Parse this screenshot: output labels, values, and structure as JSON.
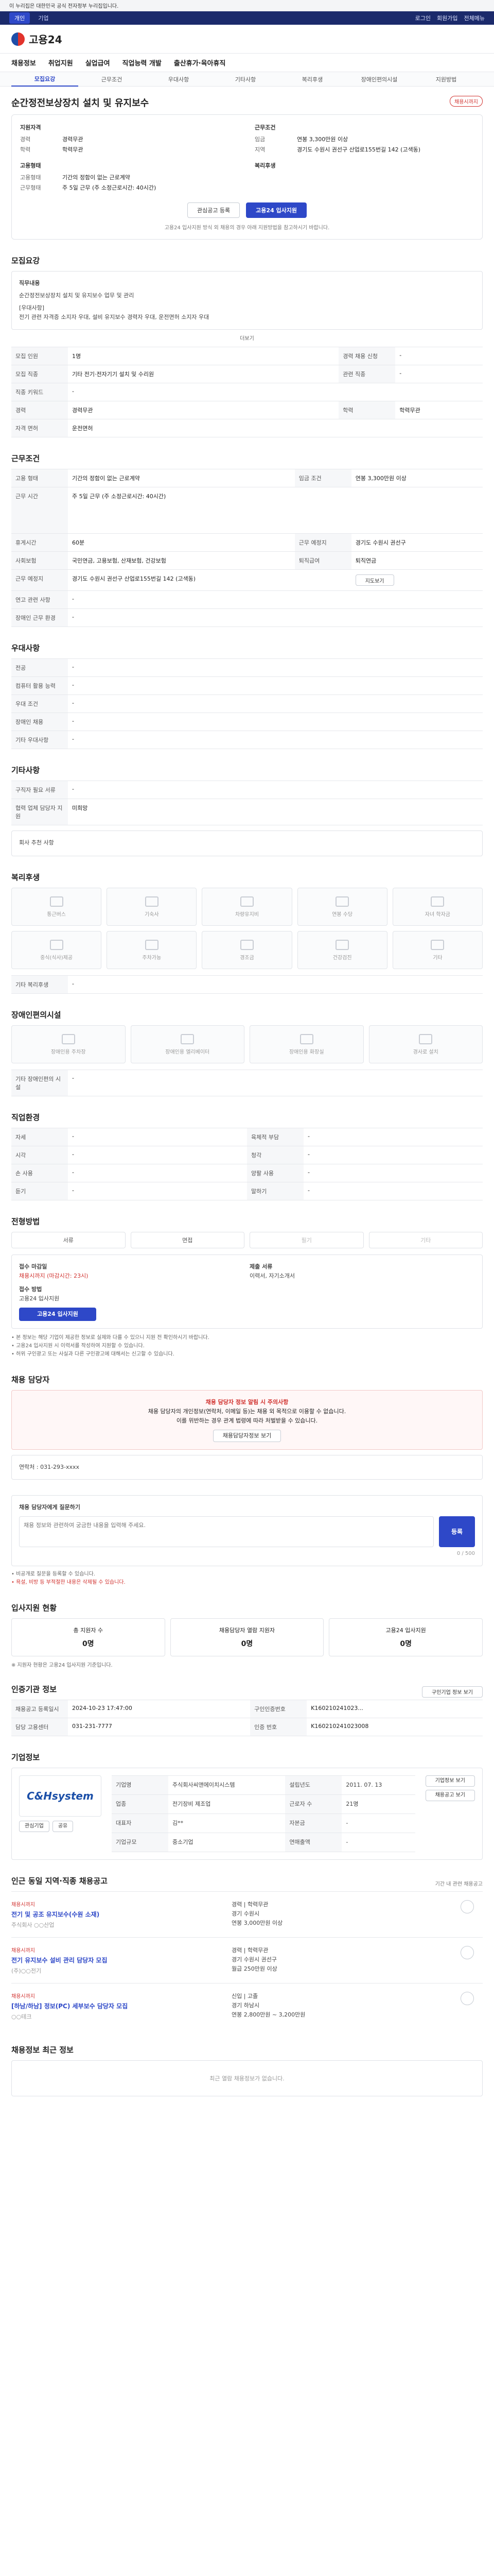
{
  "gov": {
    "text": "이 누리집은 대한민국 공식 전자정부 누리집입니다."
  },
  "site": {
    "tabs": [
      "개인",
      "기업"
    ],
    "right": [
      "로그인",
      "회원가입",
      "전체메뉴"
    ]
  },
  "logo": {
    "name": "고용24"
  },
  "gnb": [
    "채용정보",
    "취업지원",
    "실업급여",
    "직업능력 개발",
    "출산휴가·육아휴직"
  ],
  "sub_tabs": [
    "모집요강",
    "근무조건",
    "우대사항",
    "기타사항",
    "복리후생",
    "장애인편의시설",
    "지원방법"
  ],
  "job": {
    "title": "순간정전보상장치 설치 및 유지보수",
    "badge": "채용시까지"
  },
  "summary": {
    "left_h": "지원자격",
    "left": [
      {
        "k": "경력",
        "v": "경력무관"
      },
      {
        "k": "학력",
        "v": "학력무관"
      }
    ],
    "left_h2": "고용형태",
    "left2": [
      {
        "k": "고용형태",
        "v": "기간의 정함이 없는 근로계약"
      },
      {
        "k": "근무형태",
        "v": "주 5일 근무 (주 소정근로시간: 40시간)"
      }
    ],
    "right_h": "근무조건",
    "right": [
      {
        "k": "임금",
        "v": "연봉 3,300만원 이상"
      },
      {
        "k": "지역",
        "v": "경기도 수원시 권선구 산업로155번길 142 (고색동)"
      }
    ],
    "right_h2": "복리후생",
    "buttons": {
      "scrap": "관심공고 등록",
      "apply": "고용24 입사지원"
    },
    "note": "고용24 입사지원 방식 외 채용의 경우 아래 지원방법을 참고하시기 바랍니다."
  },
  "recruit": {
    "heading": "모집요강",
    "box_title": "직무내용",
    "box_lines": [
      "순간정전보상장치 설치 및 유지보수 업무 및 관리",
      "[우대사항]",
      "전기 관련 자격증 소지자 우대, 설비 유지보수 경력자 우대, 운전면허 소지자 우대"
    ],
    "more": "더보기",
    "rows": [
      {
        "k": "모집 인원",
        "v": "1명",
        "k2": "경력 채용 신청",
        "v2": "-"
      },
      {
        "k": "모집 직종",
        "v": "기타 전기·전자기기 설치 및 수리원",
        "k2": "관련 직종",
        "v2": "-"
      },
      {
        "k": "직종 키워드",
        "v": "-",
        "k2": "",
        "v2": ""
      },
      {
        "k": "경력",
        "v": "경력무관",
        "k2": "학력",
        "v2": "학력무관"
      },
      {
        "k": "자격 면허",
        "v": "운전면허",
        "k2": "",
        "v2": ""
      }
    ]
  },
  "conditions": {
    "heading": "근무조건",
    "rows": [
      {
        "k": "고용 형태",
        "v": "기간의 정함이 없는 근로계약",
        "k2": "임금 조건",
        "v2": "연봉 3,300만원 이상"
      },
      {
        "k": "근무 시간",
        "v": "주 5일 근무 (주 소정근로시간: 40시간)",
        "k2": "",
        "v2": ""
      },
      {
        "k": "휴게시간",
        "v": "60분",
        "k2": "근무 예정지",
        "v2": "경기도 수원시 권선구"
      },
      {
        "k": "사회보험",
        "v": "국민연금, 고용보험, 산재보험, 건강보험",
        "k2": "퇴직급여",
        "v2": "퇴직연금"
      },
      {
        "k": "근무 예정지",
        "v": "경기도 수원시 권선구 산업로155번길 142 (고색동)",
        "k2": "",
        "v2": ""
      },
      {
        "k": "연고 관련 사항",
        "v": "-",
        "k2": "",
        "v2": ""
      },
      {
        "k": "장애인 근무 환경",
        "v": "-",
        "k2": "",
        "v2": ""
      }
    ],
    "map_label": "지도보기"
  },
  "preference": {
    "heading": "우대사항",
    "rows": [
      {
        "k": "전공",
        "v": "-"
      },
      {
        "k": "컴퓨터 활용 능력",
        "v": "-"
      },
      {
        "k": "우대 조건",
        "v": "-"
      },
      {
        "k": "장애인 채용",
        "v": "-"
      },
      {
        "k": "기타 우대사항",
        "v": "-"
      }
    ]
  },
  "etc": {
    "heading": "기타사항",
    "rows": [
      {
        "k": "구직자 필요 서류",
        "v": "-"
      },
      {
        "k": "협력 업체 담당자 지원",
        "v": "미희망"
      }
    ],
    "extra": "회사 추천 사항"
  },
  "welfare": {
    "heading": "복리후생",
    "items": [
      "통근버스",
      "기숙사",
      "차량유지비",
      "연봉 수당",
      "자녀 학자금",
      "중식(식사)제공",
      "주차가능",
      "경조금",
      "건강검진",
      "기타"
    ],
    "etc_label": "기타 복리후생",
    "etc_value": "-"
  },
  "disability": {
    "heading": "장애인편의시설",
    "items": [
      "장애인용 주차장",
      "장애인용 엘리베이터",
      "장애인용 화장실",
      "경사로 설치"
    ],
    "etc_label": "기타 장애인편의 시설",
    "etc_value": "-"
  },
  "position": {
    "heading": "직업환경",
    "rows": [
      {
        "k": "자세",
        "v": "-",
        "k2": "육체적 부담",
        "v2": "-"
      },
      {
        "k": "시각",
        "v": "-",
        "k2": "청각",
        "v2": "-"
      },
      {
        "k": "손 사용",
        "v": "-",
        "k2": "양팔 사용",
        "v2": "-"
      },
      {
        "k": "듣기",
        "v": "-",
        "k2": "말하기",
        "v2": "-"
      }
    ]
  },
  "apply": {
    "heading": "전형방법",
    "steps": [
      "서류",
      "면접",
      "필기",
      "기타"
    ],
    "method_label": "접수 방법",
    "method_value": "고용24 입사지원",
    "deadline_label": "접수 마감일",
    "deadline_value": "채용시까지 (마감시간: 23시)",
    "apply_btn": "고용24 입사지원",
    "docs_label": "제출 서류",
    "docs_value": "이력서, 자기소개서",
    "notes": [
      "• 본 정보는 해당 기업이 제공한 정보로 실제와 다를 수 있으니 지원 전 확인하시기 바랍니다.",
      "• 고용24 입사지원 시 이력서를 작성하여 지원할 수 있습니다.",
      "• 허위 구인광고 또는 사실과 다른 구인광고에 대해서는 신고할 수 있습니다."
    ]
  },
  "contact": {
    "heading": "채용 담당자",
    "alert_title": "채용 담당자 정보 알림 시 주의사항",
    "alert_lines": [
      "채용 담당자의 개인정보(연락처, 이메일 등)는 채용 외 목적으로 이용할 수 없습니다.",
      "이를 위반하는 경우 관계 법령에 따라 처벌받을 수 있습니다."
    ],
    "show_btn": "채용담당자정보 보기",
    "phone_label": "연락처",
    "phone_value": "031-293-xxxx"
  },
  "qna": {
    "heading": "채용 담당자에게 질문하기",
    "placeholder": "채용 정보와 관련하여 궁금한 내용을 입력해 주세요.",
    "counter": "0 / 500",
    "submit": "등록",
    "notes": [
      "• 비공개로 질문을 등록할 수 있습니다.",
      "• 욕설, 비방 등 부적절한 내용은 삭제될 수 있습니다."
    ]
  },
  "stats": {
    "heading": "입사지원 현황",
    "items": [
      {
        "label": "총 지원자 수",
        "value": "0명"
      },
      {
        "label": "채용담당자 열람 지원자",
        "value": "0명"
      },
      {
        "label": "고용24 입사지원",
        "value": "0명"
      }
    ],
    "note": "※ 지원자 현황은 고용24 입사지원 기준입니다."
  },
  "info": {
    "heading": "인증기관 정보",
    "link": "구인기업 정보 보기",
    "rows": [
      {
        "k": "채용공고 등록일시",
        "v": "2024-10-23 17:47:00",
        "k2": "구인인증번호",
        "v2": "K160210241023..."
      },
      {
        "k": "담당 고용센터",
        "v": "031-231-7777",
        "k2": "인증 번호",
        "v2": "K160210241023008"
      }
    ]
  },
  "company": {
    "heading": "기업정보",
    "logo_text": "C&Hsystem",
    "rows": [
      {
        "k": "기업명",
        "v": "주식회사씨앤에이치시스템",
        "k2": "설립년도",
        "v2": "2011. 07. 13"
      },
      {
        "k": "업종",
        "v": "전기장비 제조업",
        "k2": "근로자 수",
        "v2": "21명"
      },
      {
        "k": "대표자",
        "v": "김**",
        "k2": "자본금",
        "v2": "-"
      },
      {
        "k": "기업규모",
        "v": "중소기업",
        "k2": "연매출액",
        "v2": "-"
      }
    ],
    "link1": "기업정보 보기",
    "link2": "채용공고 보기",
    "btn_follow": "관심기업",
    "btn_share": "공유"
  },
  "related": {
    "heading": "인근 동일 지역·직종 채용공고",
    "note": "기간 내 관련 채용공고",
    "items": [
      {
        "tag": "채용시까지",
        "title": "전기 및 공조 유지보수(수원 소재)",
        "company": "주식회사 ○○산업",
        "line1": "경력 | 학력무관",
        "line2": "경기 수원시",
        "line3": "연봉 3,000만원 이상"
      },
      {
        "tag": "채용시까지",
        "title": "전기 유지보수 설비 관리 담당자 모집",
        "company": "(주)○○전기",
        "line1": "경력 | 학력무관",
        "line2": "경기 수원시 권선구",
        "line3": "월급 250만원 이상"
      },
      {
        "tag": "채용시까지",
        "title": "[하남/하남] 정보(PC) 세부보수 담당자 모집",
        "company": "○○테크",
        "line1": "신입 | 고졸",
        "line2": "경기 하남시",
        "line3": "연봉 2,800만원 ~ 3,200만원"
      }
    ]
  },
  "recent": {
    "heading": "채용정보 최근 정보",
    "empty": "최근 열람 채용정보가 없습니다."
  }
}
